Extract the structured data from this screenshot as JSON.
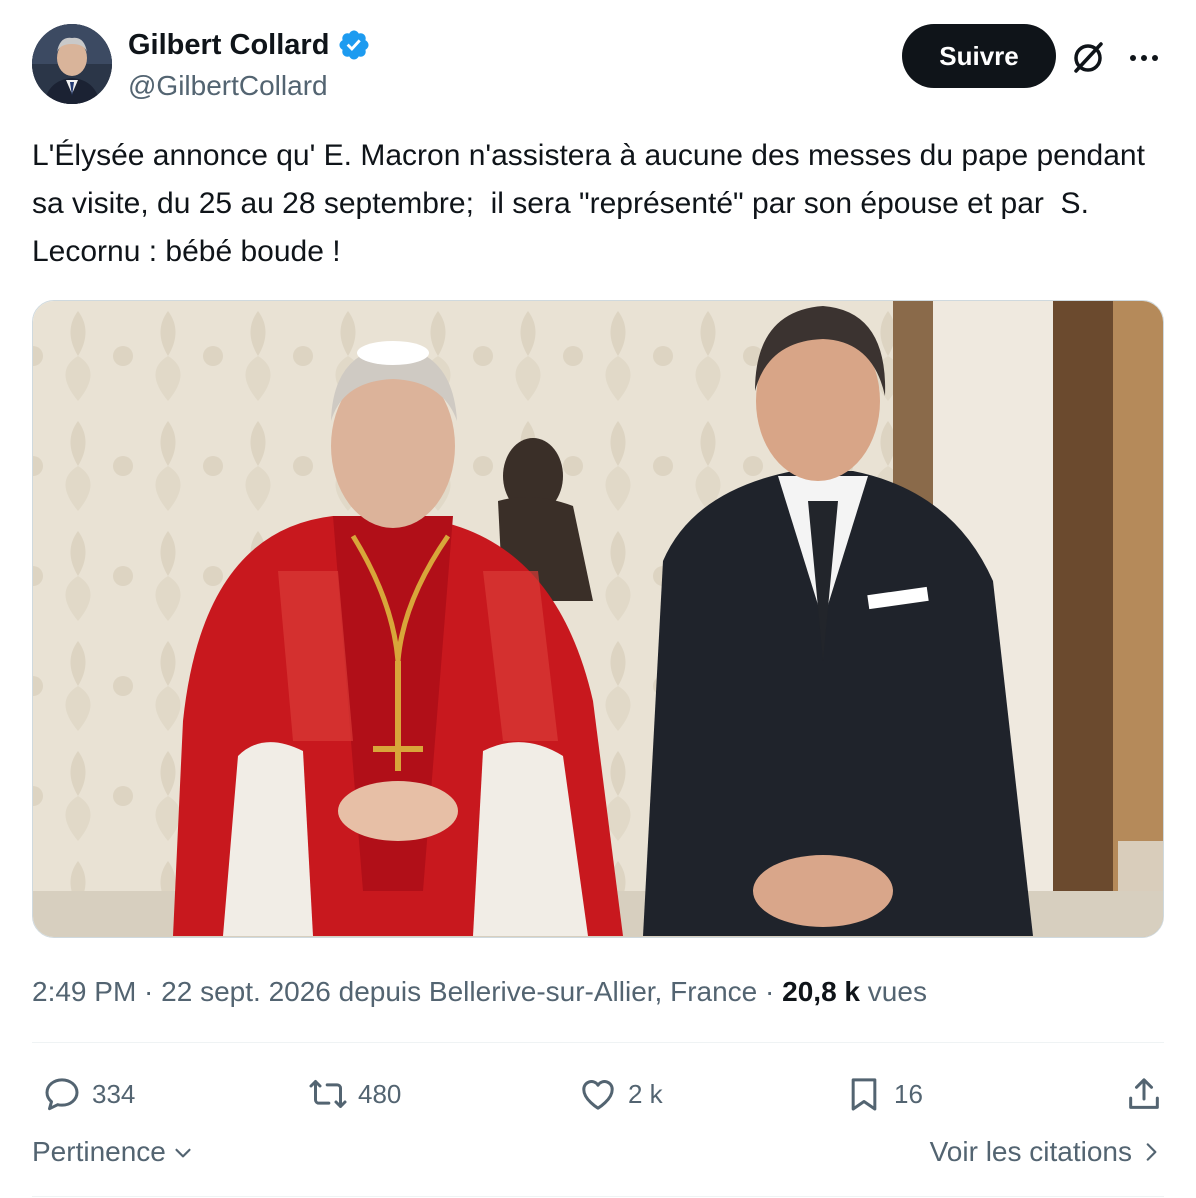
{
  "author": {
    "display_name": "Gilbert Collard",
    "handle": "@GilbertCollard",
    "verified": true
  },
  "header": {
    "follow_label": "Suivre"
  },
  "tweet": {
    "text": "L'Élysée annonce qu' E. Macron n'assistera à aucune des messes du pape pendant sa visite, du 25 au 28 septembre;  il sera \"représenté\" par son épouse et par  S. Lecornu : bébé boude !"
  },
  "meta": {
    "time": "2:49 PM",
    "separator1": " · ",
    "date_location": "22 sept. 2026 depuis Bellerive-sur-Allier, France",
    "separator2": " · ",
    "views_count": "20,8 k",
    "views_label": " vues"
  },
  "actions": {
    "replies": "334",
    "reposts": "480",
    "likes": "2 k",
    "bookmarks": "16"
  },
  "footer": {
    "sort_label": "Pertinence",
    "quotes_label": "Voir les citations"
  },
  "colors": {
    "text": "#0f1419",
    "secondary": "#536471",
    "verified": "#1d9bf0",
    "button_bg": "#0f1419"
  },
  "icons": [
    "verified-badge-icon",
    "grok-icon",
    "more-icon",
    "reply-icon",
    "repost-icon",
    "like-icon",
    "bookmark-icon",
    "share-icon",
    "chevron-down-icon",
    "chevron-right-icon"
  ]
}
